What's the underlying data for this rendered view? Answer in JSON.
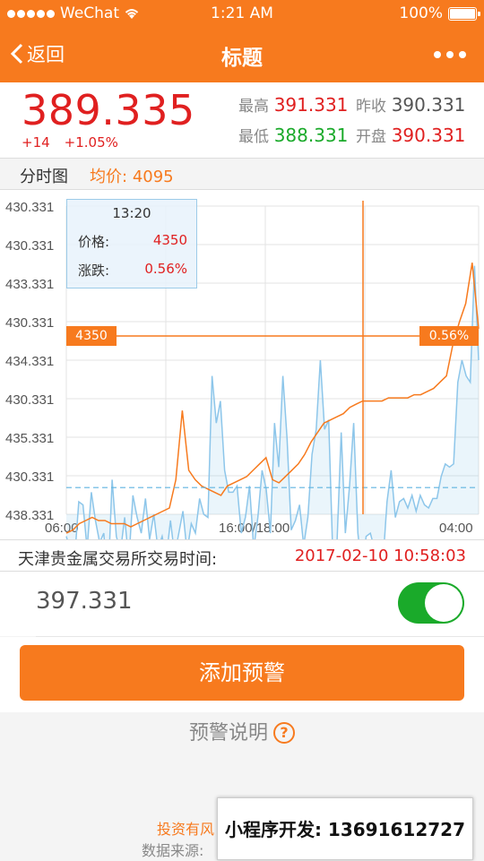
{
  "status_bar": {
    "carrier": "WeChat",
    "time": "1:21 AM",
    "battery": "100%"
  },
  "nav": {
    "back_label": "返回",
    "title": "标题"
  },
  "quote": {
    "price": "389.335",
    "change": "+14",
    "change_pct": "+1.05%",
    "high_label": "最高",
    "high": "391.331",
    "prev_close_label": "昨收",
    "prev_close": "390.331",
    "low_label": "最低",
    "low": "388.331",
    "open_label": "开盘",
    "open": "390.331"
  },
  "sub_bar": {
    "tab": "分时图",
    "avg_label": "均价:",
    "avg_value": "4095"
  },
  "tooltip": {
    "time": "13:20",
    "price_label": "价格:",
    "price": "4350",
    "change_label": "涨跌:",
    "change": "0.56%"
  },
  "crosshair": {
    "left_label": "4350",
    "right_label": "0.56%"
  },
  "chart_data": {
    "type": "line",
    "y_tick_labels": [
      "430.331",
      "430.331",
      "433.331",
      "430.331",
      "434.331",
      "430.331",
      "435.331",
      "430.331",
      "438.331"
    ],
    "x_tick_labels": [
      "06:00",
      "16:00/18:00",
      "04:00"
    ],
    "series": [
      {
        "values": [
          419,
          414,
          412,
          430,
          429,
          415,
          433,
          424,
          417,
          420,
          404,
          437,
          419,
          414,
          425,
          411,
          432,
          425,
          420,
          431,
          418,
          426,
          415,
          419,
          412,
          424,
          413,
          420,
          427,
          414,
          423,
          420,
          431,
          426,
          425,
          470,
          455,
          462,
          440,
          433,
          433,
          435,
          420,
          425,
          435,
          415,
          425,
          440,
          434,
          420,
          455,
          441,
          470,
          450,
          421,
          424,
          429,
          416,
          425,
          445,
          453,
          475,
          453,
          456,
          412,
          417,
          452,
          420,
          435,
          455,
          420,
          408,
          419,
          420,
          415,
          417,
          410,
          430,
          440,
          425,
          430,
          431,
          428,
          432,
          427,
          432,
          429,
          428,
          431,
          431,
          438,
          442,
          441,
          442,
          468,
          475,
          470,
          468,
          505,
          475
        ]
      },
      {
        "values": [
          420,
          421,
          423,
          424,
          425,
          424,
          424,
          423,
          423,
          423,
          422,
          423,
          424,
          425,
          426,
          427,
          428,
          437,
          459,
          440,
          437,
          435,
          434,
          433,
          432,
          435,
          436,
          437,
          438,
          440,
          442,
          444,
          437,
          436,
          438,
          440,
          442,
          445,
          449,
          452,
          455,
          456,
          457,
          458,
          460,
          461,
          462,
          462,
          462,
          462,
          463,
          463,
          463,
          463,
          464,
          464,
          465,
          466,
          468,
          470,
          480,
          487,
          493,
          506,
          485
        ]
      }
    ],
    "dashed_reference": 434.5,
    "ylim": [
      426,
      524
    ],
    "grid": true
  },
  "session_time": {
    "label": "天津贵金属交易所交易时间:",
    "value": "2017-02-10   10:58:03"
  },
  "alert": {
    "value": "397.331",
    "enabled": true,
    "add_button": "添加预警"
  },
  "help": {
    "label": "预警说明",
    "icon": "?"
  },
  "footer": {
    "risk": "投资有风",
    "source": "数据来源:",
    "promo": "小程序开发: 13691612727"
  },
  "colors": {
    "accent": "#f77a1e",
    "up": "#e02020",
    "down": "#1aaa2a",
    "price_line": "#8dc6ea",
    "avg_line": "#f77a1e"
  }
}
